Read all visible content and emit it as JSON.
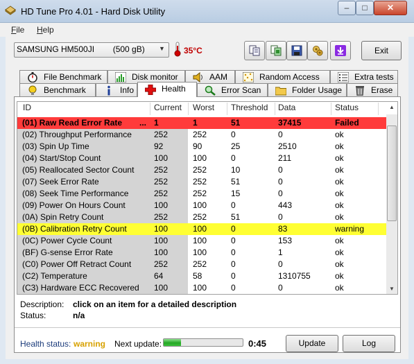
{
  "window": {
    "title": "HD Tune Pro 4.01 - Hard Disk Utility",
    "minimize_glyph": "–",
    "maximize_glyph": "□",
    "close_glyph": "✕"
  },
  "menu": {
    "file": {
      "first": "F",
      "rest": "ile"
    },
    "help": {
      "first": "H",
      "rest": "elp"
    }
  },
  "toolbar": {
    "drive": "SAMSUNG HM500JI        (500 gB)",
    "temperature": "35°C",
    "icons": [
      "copy-text-icon",
      "copy-screenshot-icon",
      "save-icon",
      "options-icon",
      "download-icon"
    ],
    "exit_label": "Exit"
  },
  "tabs": {
    "top": [
      "File Benchmark",
      "Disk monitor",
      "AAM",
      "Random Access",
      "Extra tests"
    ],
    "bottom": [
      "Benchmark",
      "Info",
      "Health",
      "Error Scan",
      "Folder Usage",
      "Erase"
    ],
    "active": "Health"
  },
  "table": {
    "columns": [
      "ID",
      "Current",
      "Worst",
      "Threshold",
      "Data",
      "Status"
    ],
    "rows": [
      {
        "id": "(01) Raw Read Error Rate",
        "dots": "...",
        "current": "1",
        "worst": "1",
        "threshold": "51",
        "data": "37415",
        "status": "Failed",
        "level": "failed"
      },
      {
        "id": "(02) Throughput Performance",
        "current": "252",
        "worst": "252",
        "threshold": "0",
        "data": "0",
        "status": "ok",
        "level": "ok"
      },
      {
        "id": "(03) Spin Up Time",
        "current": "92",
        "worst": "90",
        "threshold": "25",
        "data": "2510",
        "status": "ok",
        "level": "ok"
      },
      {
        "id": "(04) Start/Stop Count",
        "current": "100",
        "worst": "100",
        "threshold": "0",
        "data": "211",
        "status": "ok",
        "level": "ok"
      },
      {
        "id": "(05) Reallocated Sector Count",
        "current": "252",
        "worst": "252",
        "threshold": "10",
        "data": "0",
        "status": "ok",
        "level": "ok"
      },
      {
        "id": "(07) Seek Error Rate",
        "current": "252",
        "worst": "252",
        "threshold": "51",
        "data": "0",
        "status": "ok",
        "level": "ok"
      },
      {
        "id": "(08) Seek Time Performance",
        "current": "252",
        "worst": "252",
        "threshold": "15",
        "data": "0",
        "status": "ok",
        "level": "ok"
      },
      {
        "id": "(09) Power On Hours Count",
        "current": "100",
        "worst": "100",
        "threshold": "0",
        "data": "443",
        "status": "ok",
        "level": "ok"
      },
      {
        "id": "(0A) Spin Retry Count",
        "current": "252",
        "worst": "252",
        "threshold": "51",
        "data": "0",
        "status": "ok",
        "level": "ok"
      },
      {
        "id": "(0B) Calibration Retry Count",
        "current": "100",
        "worst": "100",
        "threshold": "0",
        "data": "83",
        "status": "warning",
        "level": "warning"
      },
      {
        "id": "(0C) Power Cycle Count",
        "current": "100",
        "worst": "100",
        "threshold": "0",
        "data": "153",
        "status": "ok",
        "level": "ok"
      },
      {
        "id": "(BF) G-sense Error Rate",
        "current": "100",
        "worst": "100",
        "threshold": "0",
        "data": "1",
        "status": "ok",
        "level": "ok"
      },
      {
        "id": "(C0) Power Off Retract Count",
        "current": "252",
        "worst": "252",
        "threshold": "0",
        "data": "0",
        "status": "ok",
        "level": "ok"
      },
      {
        "id": "(C2) Temperature",
        "current": "64",
        "worst": "58",
        "threshold": "0",
        "data": "1310755",
        "status": "ok",
        "level": "ok"
      },
      {
        "id": "(C3) Hardware ECC Recovered",
        "current": "100",
        "worst": "100",
        "threshold": "0",
        "data": "0",
        "status": "ok",
        "level": "ok"
      }
    ]
  },
  "description": {
    "label": "Description:",
    "value": "click on an item for a detailed description",
    "status_label": "Status:",
    "status_value": "n/a"
  },
  "footer": {
    "health_label": "Health status:",
    "health_value": "warning",
    "next_update_label": "Next update:",
    "countdown": "0:45",
    "progress_fraction": 0.22,
    "update_label": "Update",
    "log_label": "Log"
  },
  "colors": {
    "failed_row": "#ff3b3b",
    "warning_row": "#ffff33",
    "health_warning": "#d7a100",
    "progress": "#25a725"
  }
}
